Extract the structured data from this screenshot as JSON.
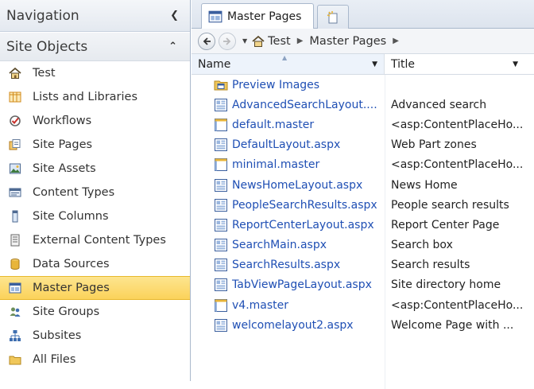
{
  "nav": {
    "title": "Navigation",
    "section_title": "Site Objects",
    "items": [
      {
        "label": "Test",
        "icon": "home-icon"
      },
      {
        "label": "Lists and Libraries",
        "icon": "list-icon"
      },
      {
        "label": "Workflows",
        "icon": "workflow-icon"
      },
      {
        "label": "Site Pages",
        "icon": "site-pages-icon"
      },
      {
        "label": "Site Assets",
        "icon": "site-assets-icon"
      },
      {
        "label": "Content Types",
        "icon": "content-types-icon"
      },
      {
        "label": "Site Columns",
        "icon": "site-columns-icon"
      },
      {
        "label": "External Content Types",
        "icon": "external-content-types-icon"
      },
      {
        "label": "Data Sources",
        "icon": "data-sources-icon"
      },
      {
        "label": "Master Pages",
        "icon": "master-pages-icon",
        "selected": true
      },
      {
        "label": "Site Groups",
        "icon": "site-groups-icon"
      },
      {
        "label": "Subsites",
        "icon": "subsites-icon"
      },
      {
        "label": "All Files",
        "icon": "folder-icon"
      }
    ]
  },
  "tabs": {
    "active_label": "Master Pages"
  },
  "breadcrumb": {
    "items": [
      "Test",
      "Master Pages"
    ]
  },
  "table": {
    "columns": {
      "name": "Name",
      "title": "Title"
    },
    "rows": [
      {
        "name": "Preview Images",
        "title": "",
        "type": "folder"
      },
      {
        "name": "AdvancedSearchLayout....",
        "title": "Advanced search",
        "type": "aspx"
      },
      {
        "name": "default.master",
        "title": "<asp:ContentPlaceHo...",
        "type": "master"
      },
      {
        "name": "DefaultLayout.aspx",
        "title": "Web Part zones",
        "type": "aspx"
      },
      {
        "name": "minimal.master",
        "title": "<asp:ContentPlaceHo...",
        "type": "master"
      },
      {
        "name": "NewsHomeLayout.aspx",
        "title": "News Home",
        "type": "aspx"
      },
      {
        "name": "PeopleSearchResults.aspx",
        "title": "People search results",
        "type": "aspx"
      },
      {
        "name": "ReportCenterLayout.aspx",
        "title": "Report Center Page",
        "type": "aspx"
      },
      {
        "name": "SearchMain.aspx",
        "title": "Search box",
        "type": "aspx"
      },
      {
        "name": "SearchResults.aspx",
        "title": "Search results",
        "type": "aspx"
      },
      {
        "name": "TabViewPageLayout.aspx",
        "title": "Site directory home",
        "type": "aspx"
      },
      {
        "name": "v4.master",
        "title": "<asp:ContentPlaceHo...",
        "type": "master"
      },
      {
        "name": "welcomelayout2.aspx",
        "title": "Welcome Page with ...",
        "type": "aspx"
      }
    ]
  },
  "colors": {
    "selected_bg": "#fbd25a",
    "link": "#1f4fb4",
    "border": "#a9b8cc"
  }
}
